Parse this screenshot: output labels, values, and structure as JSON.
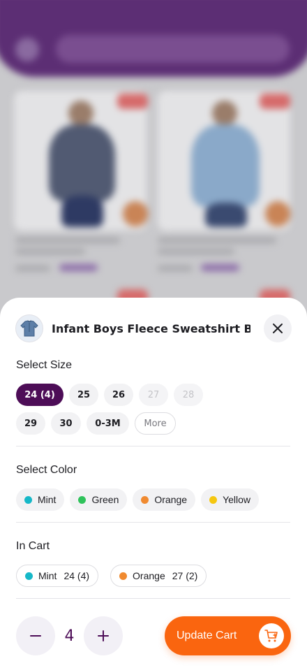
{
  "product": {
    "title": "Infant Boys Fleece Sweatshirt Boy ..",
    "thumbnail_icon": "sweatshirt-icon"
  },
  "size_section": {
    "label": "Select Size",
    "sizes": [
      {
        "label": "24 (4)",
        "state": "selected"
      },
      {
        "label": "25",
        "state": "available"
      },
      {
        "label": "26",
        "state": "available"
      },
      {
        "label": "27",
        "state": "disabled"
      },
      {
        "label": "28",
        "state": "disabled"
      },
      {
        "label": "29",
        "state": "available"
      },
      {
        "label": "30",
        "state": "available"
      },
      {
        "label": "0-3M",
        "state": "available"
      }
    ],
    "more_label": "More"
  },
  "color_section": {
    "label": "Select Color",
    "colors": [
      {
        "label": "Mint",
        "color": "#16b8c8"
      },
      {
        "label": "Green",
        "color": "#2fc25b"
      },
      {
        "label": "Orange",
        "color": "#f08a30"
      },
      {
        "label": "Yellow",
        "color": "#f5c710"
      }
    ]
  },
  "cart_section": {
    "label": "In Cart",
    "items": [
      {
        "color_label": "Mint",
        "color": "#16b8c8",
        "size": "24 (4)"
      },
      {
        "color_label": "Orange",
        "color": "#f08a30",
        "size": "27 (2)"
      }
    ]
  },
  "quantity": {
    "value": "4",
    "decrement_icon": "minus-icon",
    "increment_icon": "plus-icon"
  },
  "update_cart": {
    "label": "Update Cart",
    "icon": "cart-add-icon"
  },
  "colors": {
    "brand_purple": "#4d0d57",
    "accent_orange": "#fa650f"
  }
}
